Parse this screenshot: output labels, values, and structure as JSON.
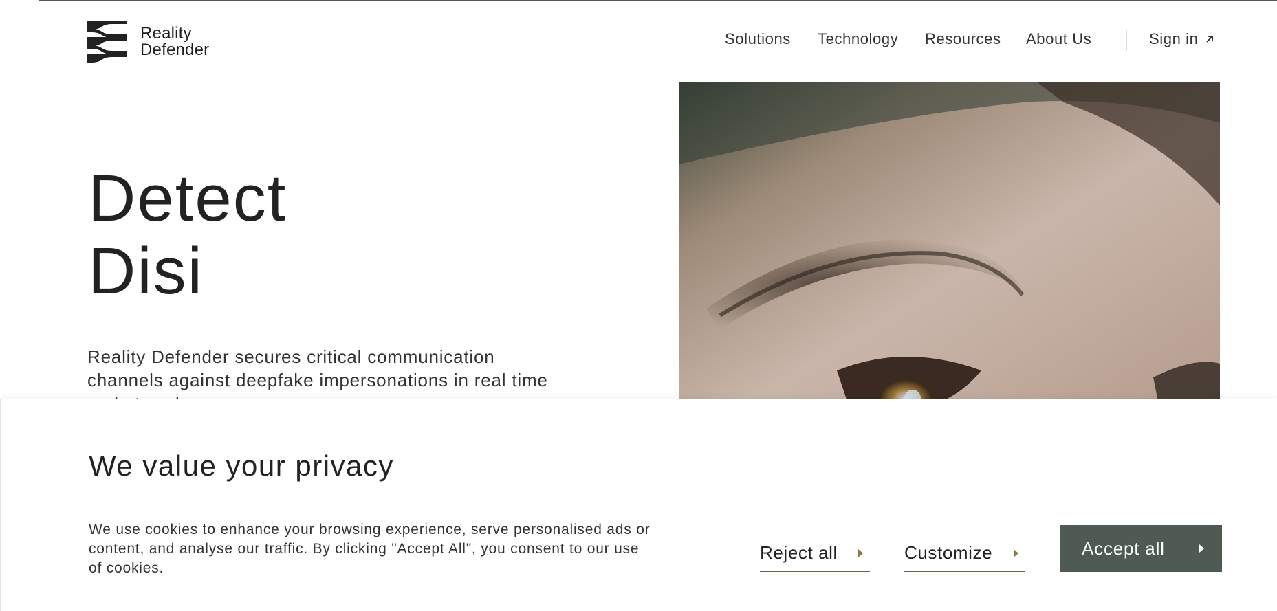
{
  "brand": {
    "name_line1": "Reality",
    "name_line2": "Defender",
    "logo_icon": "striped-wave-logo"
  },
  "nav": {
    "items": [
      {
        "label": "Solutions"
      },
      {
        "label": "Technology"
      },
      {
        "label": "Resources"
      },
      {
        "label": "About Us"
      }
    ],
    "sign_in": {
      "label": "Sign in",
      "icon": "arrow-up-right-icon"
    }
  },
  "hero": {
    "title_line1": "Detect",
    "title_line2": "Disi",
    "description": "Reality Defender secures critical communication channels against deepfake impersonations in real time and at scale."
  },
  "cookie_banner": {
    "title": "We value your privacy",
    "text": "We use cookies to enhance your browsing experience, serve personalised ads or content, and analyse our traffic. By clicking \"Accept All\", you consent to our use of cookies.",
    "reject_label": "Reject all",
    "customize_label": "Customize",
    "accept_label": "Accept all"
  },
  "colors": {
    "accent_dark": "#4f5a52",
    "underline": "#5c6b3a",
    "text": "#222222"
  }
}
